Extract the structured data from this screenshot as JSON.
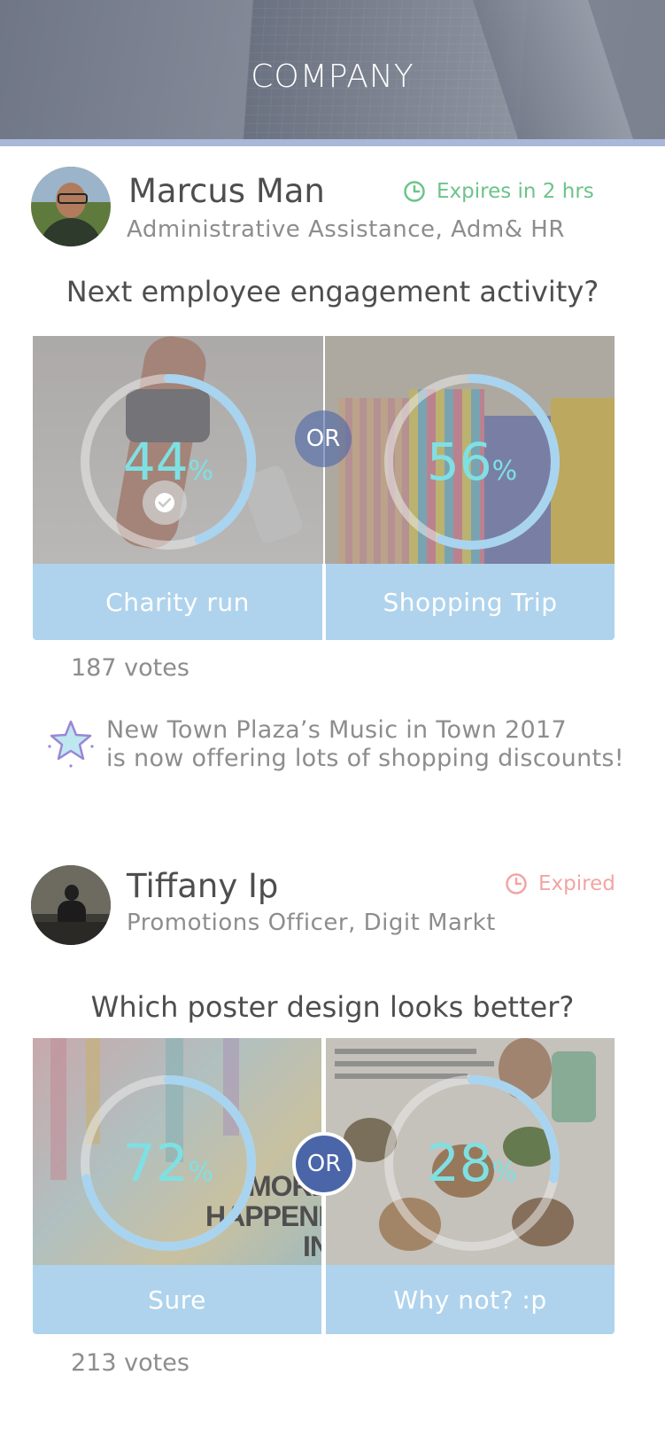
{
  "header": {
    "title": "COMPANY"
  },
  "posts": [
    {
      "author": "Marcus Man",
      "role": "Administrative Assistance, Adm& HR",
      "expiry": "Expires in 2 hrs",
      "expiry_color": "#6cc38a",
      "question": "Next employee engagement activity?",
      "options": [
        {
          "label": "Charity run",
          "percent": "44",
          "percent_value": 44,
          "selected": true
        },
        {
          "label": "Shopping Trip",
          "percent": "56",
          "percent_value": 56,
          "selected": false
        }
      ],
      "or_label": "OR",
      "votes": "187 votes",
      "promo_icon": "star-icon",
      "promo_line1": "New Town Plaza’s Music in Town 2017",
      "promo_line2": "is now offering lots of shopping discounts!"
    },
    {
      "author": "Tiffany Ip",
      "role": "Promotions Officer, Digit Markt",
      "expiry": "Expired",
      "expiry_color": "#f3a4a4",
      "question": "Which poster design looks better?",
      "options": [
        {
          "label": "Sure",
          "percent": "72",
          "percent_value": 72,
          "selected": false
        },
        {
          "label": "Why not? :p",
          "percent": "28",
          "percent_value": 28,
          "selected": false
        }
      ],
      "or_label": "OR",
      "votes": "213 votes",
      "poster_text": "MORE HAPPENINGS IN"
    }
  ],
  "colors": {
    "accent_button": "#afd3ec",
    "percent_text": "#7fe0e4",
    "ring_fill": "#a9d4ef",
    "or_badge": "#4a65a8"
  }
}
